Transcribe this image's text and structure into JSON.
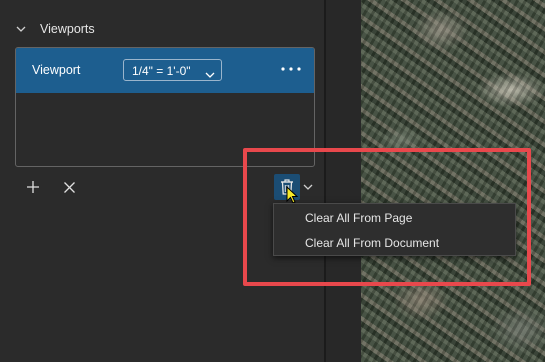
{
  "panel": {
    "section_title": "Viewports",
    "rows": [
      {
        "label": "Viewport",
        "scale": "1/4\" = 1'-0\""
      }
    ]
  },
  "toolbar": {
    "add_icon": "plus-icon",
    "remove_icon": "x-icon",
    "delete_icon": "trash-icon"
  },
  "delete_menu": {
    "items": [
      "Clear All From Page",
      "Clear All From Document"
    ]
  },
  "colors": {
    "selection": "#1d5e8f",
    "highlight": "#e8484c",
    "panel_bg": "#2b2b2b"
  }
}
